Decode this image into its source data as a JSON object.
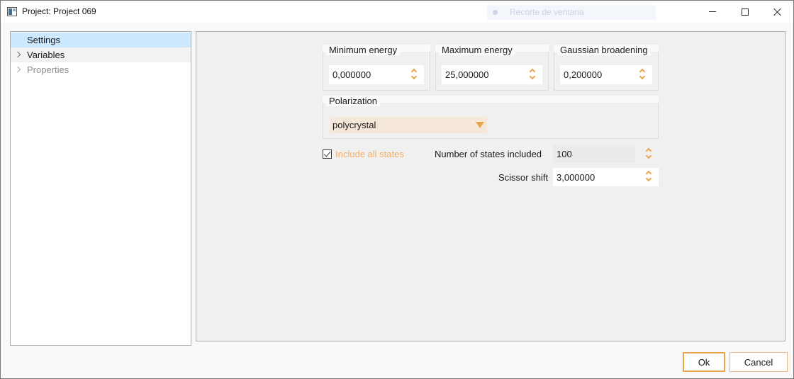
{
  "window": {
    "title": "Project: Project 069",
    "ghost_text": "Recorte de ventana"
  },
  "tree": {
    "items": [
      {
        "label": "Settings",
        "state": "selected",
        "expandable": false
      },
      {
        "label": "Variables",
        "state": "hover",
        "expandable": true
      },
      {
        "label": "Properties",
        "state": "disabled",
        "expandable": true
      }
    ]
  },
  "settings": {
    "min_energy": {
      "label": "Minimum energy",
      "value": "0,000000"
    },
    "max_energy": {
      "label": "Maximum energy",
      "value": "25,000000"
    },
    "gaussian": {
      "label": "Gaussian broadening",
      "value": "0,200000"
    },
    "polarization": {
      "label": "Polarization",
      "value": "polycrystal"
    },
    "include_all_states": {
      "label": "Include all states",
      "checked": true
    },
    "num_states": {
      "label": "Number of states included",
      "value": "100"
    },
    "scissor": {
      "label": "Scissor shift",
      "value": "3,000000"
    }
  },
  "footer": {
    "ok_label": "Ok",
    "cancel_label": "Cancel"
  },
  "colors": {
    "accent": "#e8a44e",
    "selection": "#cce8ff",
    "dropdown_bg": "#f5e8db"
  }
}
